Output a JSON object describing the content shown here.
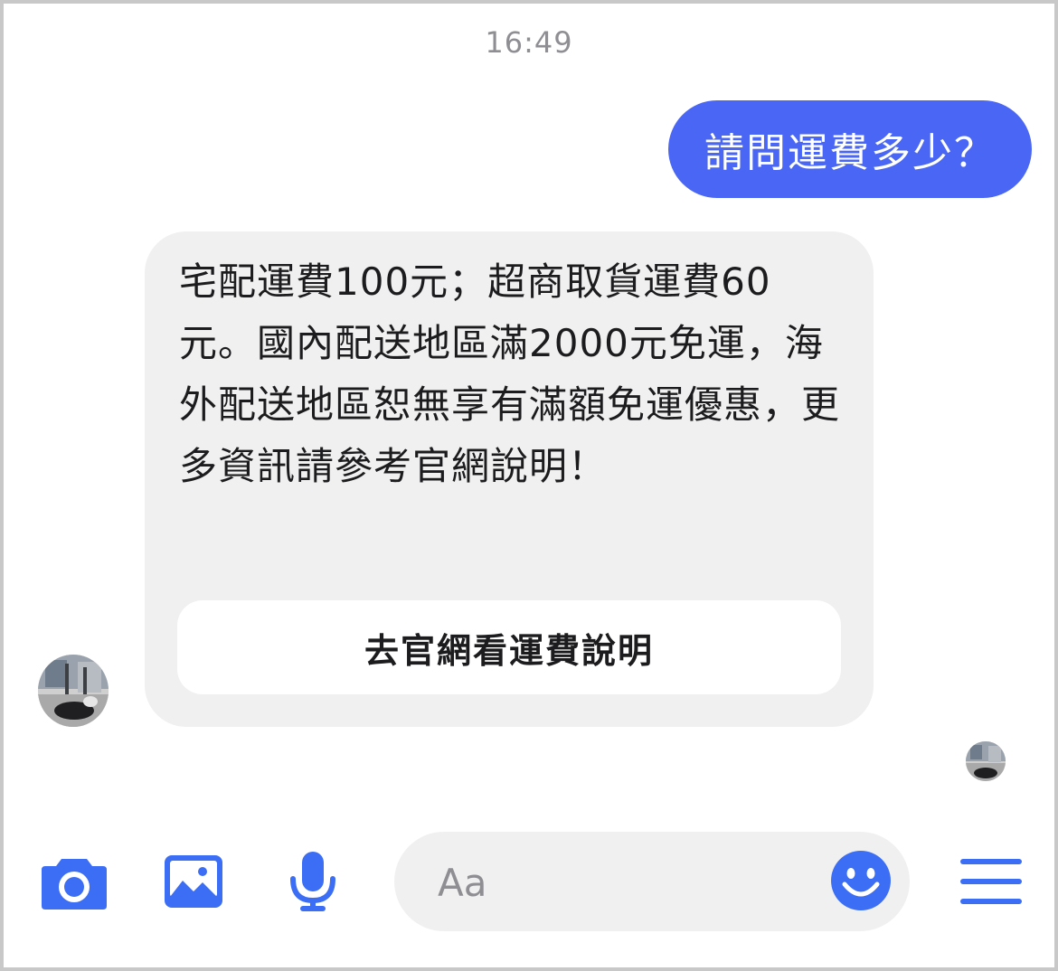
{
  "header": {
    "timestamp": "16:49"
  },
  "messages": [
    {
      "direction": "outgoing",
      "text": "請問運費多少？"
    },
    {
      "direction": "incoming",
      "text": "宅配運費100元；超商取貨運費60元。國內配送地區滿2000元免運，海外配送地區恕無享有滿額免運優惠，更多資訊請參考官網說明！",
      "button_label": "去官網看運費說明"
    }
  ],
  "composer": {
    "placeholder": "Aa"
  },
  "icons": {
    "camera": "camera-icon",
    "gallery": "image-icon",
    "voice": "microphone-icon",
    "emoji": "emoji-icon",
    "menu": "menu-icon"
  },
  "colors": {
    "accent": "#4a66f5",
    "icon": "#3b6ef5",
    "incoming_bubble": "#f0f0f0",
    "muted_text": "#8e8e93"
  }
}
